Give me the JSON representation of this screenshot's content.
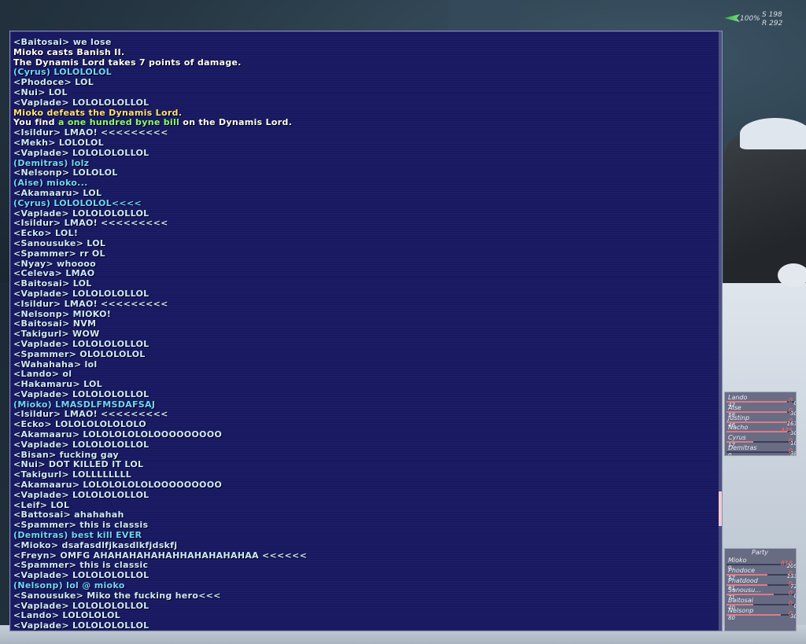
{
  "status": {
    "percent": "100%",
    "s": "S 198",
    "r": "R 292"
  },
  "chat": [
    {
      "text": "<Baitosai> we lose",
      "type": "say"
    },
    {
      "text": "Mioko casts Banish II.",
      "type": "sys"
    },
    {
      "text": "The Dynamis Lord takes 7 points of damage.",
      "type": "sys"
    },
    {
      "text": "(Cyrus) LOLOLOLOL",
      "type": "party2"
    },
    {
      "text": "<Phodoce> LOL",
      "type": "say"
    },
    {
      "text": "<Nui> LOL",
      "type": "say"
    },
    {
      "text": "<Vaplade> LOLOLOLOLLOL",
      "type": "say"
    },
    {
      "text": "Mioko defeats the Dynamis Lord.",
      "type": "sysy"
    },
    {
      "text": "You find ",
      "type": "sys",
      "item": "a one hundred byne bill",
      "suffix": " on the Dynamis Lord."
    },
    {
      "text": "<Isildur> LMAO! <<<<<<<<<",
      "type": "say"
    },
    {
      "text": "<Mekh> LOLOLOL",
      "type": "say"
    },
    {
      "text": "<Vaplade> LOLOLOLOLLOL",
      "type": "say"
    },
    {
      "text": "(Demitras) lolz",
      "type": "party2"
    },
    {
      "text": "<Nelsonp> LOLOLOL",
      "type": "say"
    },
    {
      "text": "(Aise) mioko...",
      "type": "party2"
    },
    {
      "text": "<Akamaaru> LOL",
      "type": "say"
    },
    {
      "text": "(Cyrus) LOLOLOLOL<<<<",
      "type": "party2"
    },
    {
      "text": "<Vaplade> LOLOLOLOLLOL",
      "type": "say"
    },
    {
      "text": "<Isildur> LMAO! <<<<<<<<<",
      "type": "say"
    },
    {
      "text": "<Ecko> LOL!",
      "type": "say"
    },
    {
      "text": "<Sanousuke> LOL",
      "type": "say"
    },
    {
      "text": "<Spammer> rr OL",
      "type": "say"
    },
    {
      "text": "<Nyay> whoooo",
      "type": "say"
    },
    {
      "text": "<Celeva> LMAO",
      "type": "say"
    },
    {
      "text": "<Baitosai> LOL",
      "type": "say"
    },
    {
      "text": "<Vaplade> LOLOLOLOLLOL",
      "type": "say"
    },
    {
      "text": "<Isildur> LMAO! <<<<<<<<<",
      "type": "say"
    },
    {
      "text": "<Nelsonp> MIOKO!",
      "type": "say"
    },
    {
      "text": "<Baitosai> NVM",
      "type": "say"
    },
    {
      "text": "<Takigurl> WOW",
      "type": "say"
    },
    {
      "text": "<Vaplade> LOLOLOLOLLOL",
      "type": "say"
    },
    {
      "text": "<Spammer> OLOLOLOLOL",
      "type": "say"
    },
    {
      "text": "<Wahahaha> lol",
      "type": "say"
    },
    {
      "text": "<Lando> ol",
      "type": "say"
    },
    {
      "text": "<Hakamaru> LOL",
      "type": "say"
    },
    {
      "text": "<Vaplade> LOLOLOLOLLOL",
      "type": "say"
    },
    {
      "text": "(Mioko) LMASDLFMSDAFSAJ",
      "type": "party2"
    },
    {
      "text": "<Isildur> LMAO! <<<<<<<<<",
      "type": "say"
    },
    {
      "text": "<Ecko> LOLOLOLOLOLOLO",
      "type": "say"
    },
    {
      "text": "<Akamaaru> LOLOLOLOLOLOOOOOOOOO",
      "type": "say"
    },
    {
      "text": "<Vaplade> LOLOLOLOLLOL",
      "type": "say"
    },
    {
      "text": "<Bisan> fucking gay",
      "type": "say"
    },
    {
      "text": "<Nui> DOT KILLED IT LOL",
      "type": "say"
    },
    {
      "text": "<Takigurl> LOLLLLLLLL",
      "type": "say"
    },
    {
      "text": "<Akamaaru> LOLOLOLOLOLOOOOOOOOO",
      "type": "say"
    },
    {
      "text": "<Vaplade> LOLOLOLOLLOL",
      "type": "say"
    },
    {
      "text": "<Leif> LOL",
      "type": "say"
    },
    {
      "text": "<Battosai> ahahahah",
      "type": "say"
    },
    {
      "text": "<Spammer> this is classis",
      "type": "say"
    },
    {
      "text": "(Demitras) best kill EVER",
      "type": "party2"
    },
    {
      "text": "<Mioko> dsafasdlfjkasdlkfjdskfj",
      "type": "say"
    },
    {
      "text": "<Freyn> OMFG AHAHAHAHAHAHHAHAHAHAHAA <<<<<<",
      "type": "say"
    },
    {
      "text": "<Spammer> this is classic",
      "type": "say"
    },
    {
      "text": "<Vaplade> LOLOLOLOLLOL",
      "type": "say"
    },
    {
      "text": "(Nelsonp) lol @ mioko",
      "type": "party2"
    },
    {
      "text": "<Sanousuke> Miko the fucking hero<<<",
      "type": "say"
    },
    {
      "text": "<Vaplade> LOLOLOLOLLOL",
      "type": "say"
    },
    {
      "text": "<Lando> LOLOLOLOL",
      "type": "say"
    },
    {
      "text": "<Vaplade> LOLOLOLOLLOL",
      "type": "say"
    }
  ],
  "alliance": [
    {
      "name": "Lando",
      "hp": "42",
      "mp": "0",
      "tp": "0",
      "hp_fraction": 0.9
    },
    {
      "name": "Aise",
      "hp": "58",
      "mp": "0",
      "tp": "30",
      "hp_fraction": 0.9
    },
    {
      "name": "Justinp",
      "hp": "46",
      "mp": "0",
      "tp": "167",
      "hp_fraction": 0.9
    },
    {
      "name": "Nacho",
      "hp": "",
      "mp": "435",
      "tp": "30",
      "hp_fraction": 0.9
    },
    {
      "name": "Cyrus",
      "hp": "17",
      "mp": "0",
      "tp": "10",
      "hp_fraction": 0.4
    },
    {
      "name": "Demitras",
      "hp": "0",
      "mp": "0",
      "tp": "38",
      "hp_fraction": 0.0
    }
  ],
  "party": {
    "title": "Party",
    "members": [
      {
        "name": "Mioko",
        "hp": "0",
        "mp": "818",
        "tp": "209",
        "hp_fraction": 0.0
      },
      {
        "name": "Phodoce",
        "hp": "57",
        "mp": "0",
        "tp": "133",
        "hp_fraction": 0.6
      },
      {
        "name": "Phatdood",
        "hp": "61",
        "mp": "0",
        "tp": "72",
        "hp_fraction": 0.6
      },
      {
        "name": "Sanousu...",
        "hp": "71",
        "mp": "0",
        "tp": "0",
        "hp_fraction": 0.7
      },
      {
        "name": "Baitosai",
        "hp": "40",
        "mp": "0",
        "tp": "0",
        "hp_fraction": 0.4
      },
      {
        "name": "Nelsonp",
        "hp": "80",
        "mp": "0",
        "tp": "30",
        "hp_fraction": 0.8
      }
    ]
  }
}
